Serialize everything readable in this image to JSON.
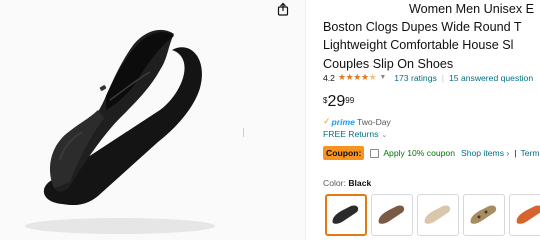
{
  "product": {
    "title_lines": [
      "Women Men Unisex E",
      "Boston Clogs Dupes Wide Round T",
      "Lightweight Comfortable House Sl",
      "Couples Slip On Shoes"
    ],
    "rating_value": "4.2",
    "stars_full": "★★★★",
    "stars_half": "★",
    "ratings_link": "173 ratings",
    "separator": "|",
    "answered_link": "15 answered question",
    "price_currency": "$",
    "price_whole": "29",
    "price_fraction": "99",
    "prime_check": "✓",
    "prime_label": "prime",
    "delivery": "Two-Day",
    "returns_link": "FREE Returns",
    "returns_chevron": "⌄",
    "coupon_badge": "Coupon:",
    "coupon_text": "Apply 10% coupon",
    "shop_items": "Shop items ›",
    "pipe": "|",
    "terms": "Terms",
    "color_label": "Color:",
    "color_value": "Black"
  },
  "swatches": [
    {
      "name": "Black",
      "color": "#2a2a2a",
      "selected": true
    },
    {
      "name": "Brown",
      "color": "#7b5a45",
      "selected": false
    },
    {
      "name": "Beige",
      "color": "#d9c6ad",
      "selected": false
    },
    {
      "name": "Leopard",
      "color": "#a88d63",
      "selected": false
    },
    {
      "name": "Orange",
      "color": "#d8642d",
      "selected": false
    }
  ],
  "colors": {
    "link": "#007185",
    "star": "#de7921",
    "coupon": "#f7931e",
    "apply": "#007600",
    "prime": "#1a98ff",
    "swatch_selected_border": "#e47911"
  },
  "icons": {
    "share": "share-icon",
    "rating_caret": "chevron-down-icon"
  }
}
